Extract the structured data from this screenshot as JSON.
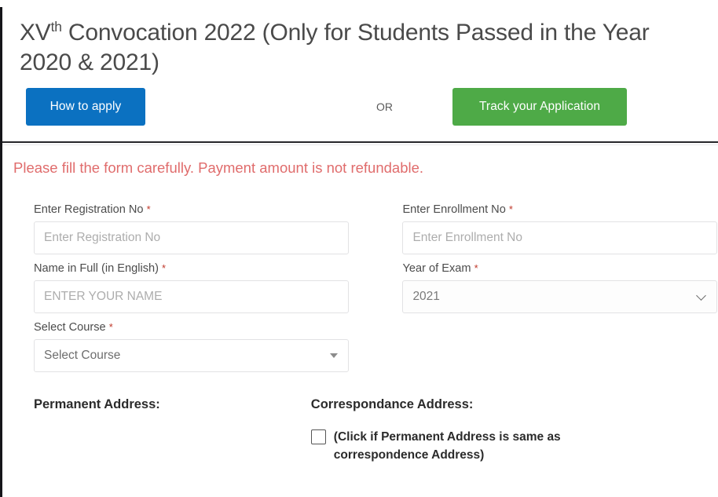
{
  "banner": {
    "alt": "convocation-photo-strip"
  },
  "header": {
    "title_main_1": "XV",
    "title_sup": "th",
    "title_main_2": " Convocation 2022 (Only for Students Passed in the Year 2020 & 2021)",
    "how_to_apply_label": "How to apply",
    "or_label": "OR",
    "track_application_label": "Track your Application"
  },
  "notice": {
    "text": "Please fill the form carefully. Payment amount is not refundable."
  },
  "form": {
    "required_marker": "*",
    "registration_no": {
      "label": "Enter Registration No",
      "placeholder": "Enter Registration No",
      "value": ""
    },
    "enrollment_no": {
      "label": "Enter Enrollment No",
      "placeholder": "Enter Enrollment No",
      "value": ""
    },
    "name_full": {
      "label": "Name in Full (in English)",
      "placeholder": "ENTER YOUR NAME",
      "value": ""
    },
    "year_of_exam": {
      "label": "Year of Exam",
      "selected": "2021"
    },
    "select_course": {
      "label": "Select Course",
      "selected": "Select Course"
    }
  },
  "address": {
    "permanent_heading": "Permanent Address:",
    "correspondance_heading": "Correspondance Address:",
    "same_as_checkbox_label": "(Click if Permanent Address is same as correspondence Address)"
  },
  "colors": {
    "primary_button": "#0b71c1",
    "success_button": "#4eaa47",
    "notice_text": "#e06c6c",
    "required_marker": "#c0392b"
  }
}
